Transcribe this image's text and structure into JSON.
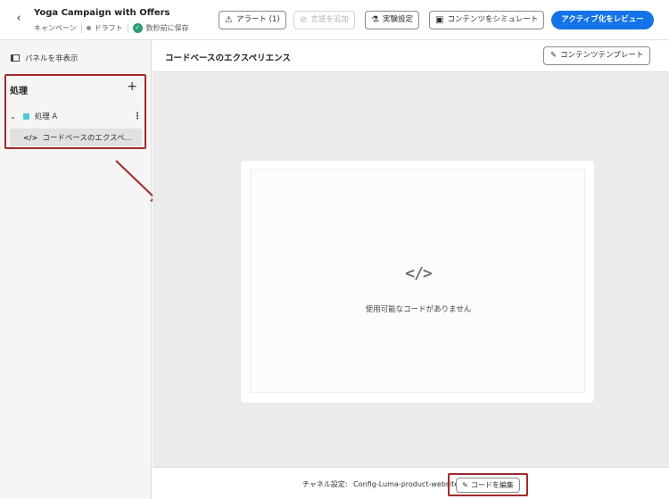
{
  "header": {
    "title": "Yoga Campaign with Offers",
    "meta": {
      "type": "キャンペーン",
      "status": "ドラフト",
      "saved": "数秒前に保存"
    },
    "buttons": {
      "alerts": "アラート (1)",
      "add_language": "言語を追加",
      "experiment": "実験設定",
      "simulate": "コンテンツをシミュレート",
      "review": "アクティブ化をレビュー"
    }
  },
  "left_panel": {
    "hide_panel": "パネルを非表示",
    "treatments_title": "処理",
    "treatment_a": "処理 A",
    "code_item": "コードベースのエクスペ..."
  },
  "main": {
    "title": "コードベースのエクスペリエンス",
    "template_button": "コンテンツテンプレート",
    "code_glyph": "</>",
    "empty_message": "使用可能なコードがありません",
    "channel_label": "チャネル設定:",
    "channel_value": "Config-Luma-product-website",
    "edit_code": "コードを編集"
  },
  "colors": {
    "accent": "#1473e6",
    "highlight": "#a12a2a",
    "treatment": "#4ec9d6",
    "success": "#2d9d78"
  }
}
